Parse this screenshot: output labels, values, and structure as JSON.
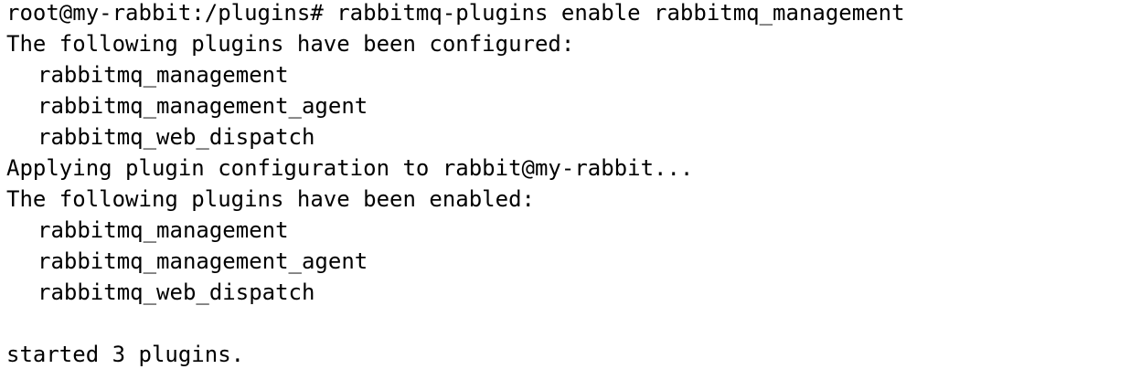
{
  "terminal": {
    "prompt": "root@my-rabbit:/plugins# ",
    "command": "rabbitmq-plugins enable rabbitmq_management",
    "configured_header": "The following plugins have been configured:",
    "configured_plugins": [
      "rabbitmq_management",
      "rabbitmq_management_agent",
      "rabbitmq_web_dispatch"
    ],
    "applying_line": "Applying plugin configuration to rabbit@my-rabbit...",
    "enabled_header": "The following plugins have been enabled:",
    "enabled_plugins": [
      "rabbitmq_management",
      "rabbitmq_management_agent",
      "rabbitmq_web_dispatch"
    ],
    "started_line": "started 3 plugins."
  },
  "colors": {
    "background": "#ffffff",
    "text": "#000000"
  }
}
